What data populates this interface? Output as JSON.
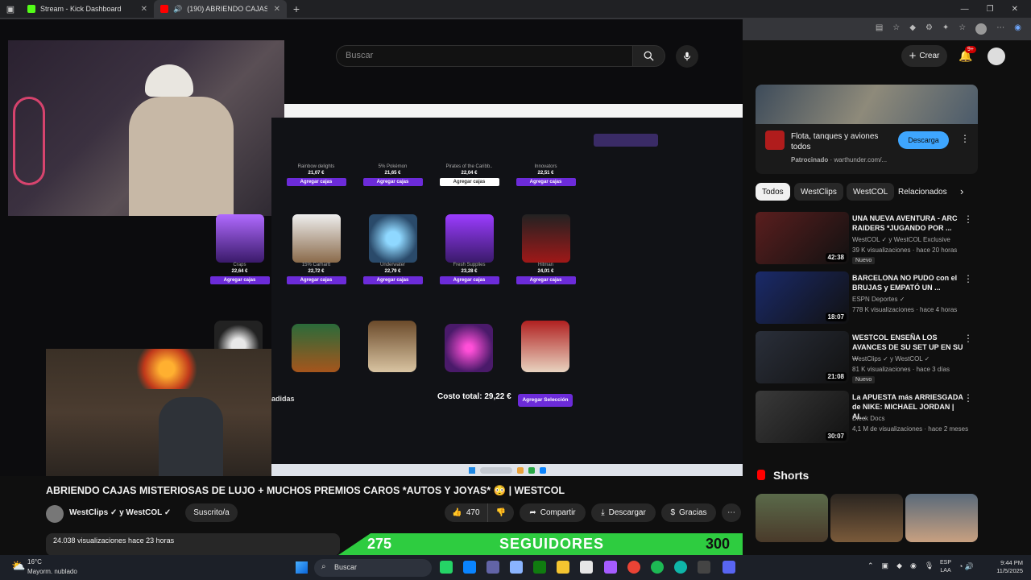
{
  "tabs": [
    {
      "label": "Stream - Kick Dashboard",
      "active": false
    },
    {
      "label": "(190) ABRIENDO CAJAS MIS",
      "active": true
    }
  ],
  "header": {
    "search_placeholder": "Buscar",
    "create_label": "Crear",
    "notif_count": "9+"
  },
  "stream": {
    "row1": [
      {
        "name": "Rainbow delights",
        "price": "21,07 €"
      },
      {
        "name": "5% Pokémon",
        "price": "21,65 €"
      },
      {
        "name": "Pirates of the Caribb..",
        "price": "22,04 €"
      },
      {
        "name": "Innovators",
        "price": "22,51 €"
      }
    ],
    "row2": [
      {
        "name": "Craps",
        "price": "22,64 €"
      },
      {
        "name": "15% Carhartt",
        "price": "22,72 €"
      },
      {
        "name": "Underwater",
        "price": "22,79 €"
      },
      {
        "name": "Fresh Supplies",
        "price": "23,28 €"
      },
      {
        "name": "Hitman",
        "price": "24,01 €"
      }
    ],
    "add_box_label": "Agregar cajas",
    "selected_label": "adidas",
    "total_label": "Costo total: 29,22 €",
    "add_selection_label": "Agregar Selección"
  },
  "overlay": {
    "followers_current": "275",
    "followers_label": "SEGUIDORES",
    "followers_goal": "300",
    "followers_progress": 0.917
  },
  "video": {
    "title": "ABRIENDO CAJAS MISTERIOSAS DE LUJO + MUCHOS PREMIOS CAROS *AUTOS Y JOYAS* 😳 | WESTCOL",
    "channel": "WestClips ✓ y WestCOL ✓",
    "subscribed_label": "Suscrito/a",
    "likes": "470",
    "share_label": "Compartir",
    "download_label": "Descargar",
    "thanks_label": "Gracias",
    "views": "24.038 visualizaciones  hace 23 horas"
  },
  "ad": {
    "title": "Flota, tanques y aviones todos",
    "sponsored": "Patrocinado",
    "domain": "warthunder.com/...",
    "cta": "Descarga"
  },
  "filters": [
    "Todos",
    "WestClips",
    "WestCOL",
    "Relacionados"
  ],
  "recommendations": [
    {
      "title": "UNA NUEVA AVENTURA - ARC RAIDERS *JUGANDO POR ...",
      "channel": "WestCOL ✓ y WestCOL Exclusive",
      "meta": "39 K visualizaciones · hace 20 horas",
      "duration": "42:38",
      "badge": "Nuevo",
      "thumb_color": "#5a1e1e"
    },
    {
      "title": "BARCELONA NO PUDO con el BRUJAS y EMPATÓ UN ...",
      "channel": "ESPN Deportes ✓",
      "meta": "778 K visualizaciones · hace 4 horas",
      "duration": "18:07",
      "badge": "",
      "thumb_color": "#1a2a6a"
    },
    {
      "title": "WESTCOL ENSEÑA LOS AVANCES DE SU SET UP EN SU ...",
      "channel": "WestClips ✓ y WestCOL ✓",
      "meta": "81 K visualizaciones · hace 3 días",
      "duration": "21:08",
      "badge": "Nuevo",
      "thumb_color": "#2a2f3a"
    },
    {
      "title": "La APUESTA más ARRIESGADA de NIKE: MICHAEL JORDAN | AI...",
      "channel": "Dieck Docs",
      "meta": "4,1 M de visualizaciones · hace 2 meses",
      "duration": "30:07",
      "badge": "",
      "thumb_color": "#3a3a3a"
    }
  ],
  "shorts_label": "Shorts",
  "weather": {
    "temp": "16°C",
    "desc": "Mayorm. nublado"
  },
  "taskbar": {
    "search": "Buscar",
    "lang": "ESP",
    "region": "LAA",
    "time": "9:44 PM",
    "date": "11/5/2025"
  }
}
